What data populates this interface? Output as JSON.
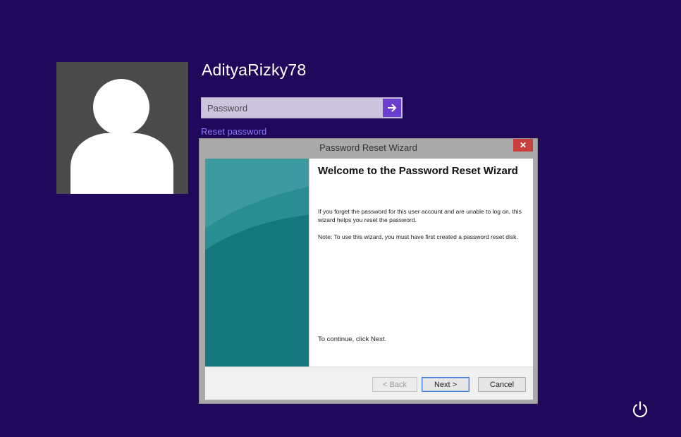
{
  "user": {
    "name": "AdityaRizky78",
    "avatar_icon": "user-silhouette-icon"
  },
  "password": {
    "placeholder": "Password",
    "value": "",
    "submit_icon": "arrow-right-icon"
  },
  "reset_link": "Reset password",
  "wizard": {
    "title": "Password Reset Wizard",
    "close_icon": "close-icon",
    "heading": "Welcome to the Password Reset Wizard",
    "body1": "If you forget the password for this user account and are unable to log on, this wizard helps you reset the password.",
    "body2": "Note: To use this wizard, you must have first created a password reset disk.",
    "continue_text": "To continue, click Next.",
    "buttons": {
      "back": "< Back",
      "next": "Next >",
      "cancel": "Cancel"
    }
  },
  "power_icon": "power-icon",
  "colors": {
    "background": "#20075a",
    "accent": "#6a3fd0",
    "link": "#8a7cff",
    "wizard_sidebar": "#177f85"
  }
}
